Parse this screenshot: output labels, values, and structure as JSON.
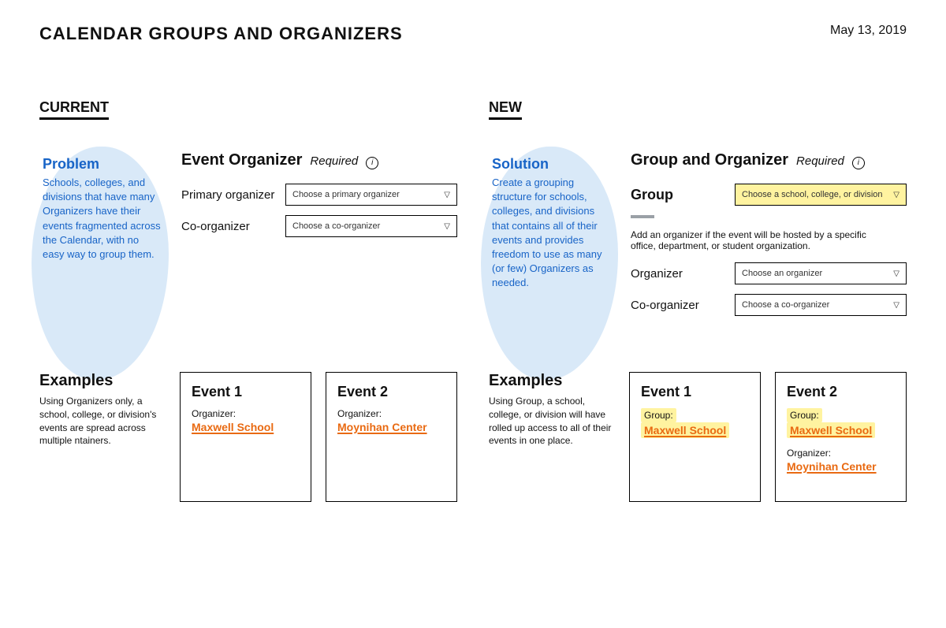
{
  "header": {
    "title": "CALENDAR GROUPS AND ORGANIZERS",
    "date": "May 13, 2019"
  },
  "current": {
    "section_label": "CURRENT",
    "annotation": {
      "title": "Problem",
      "body": "Schools, colleges, and divisions that have many Organizers have their events fragmented across the Calendar, with no easy way to group them."
    },
    "form": {
      "heading": "Event Organizer",
      "required": "Required",
      "rows": {
        "primary": {
          "label": "Primary organizer",
          "placeholder": "Choose a primary organizer"
        },
        "co": {
          "label": "Co-organizer",
          "placeholder": "Choose a co-organizer"
        }
      }
    },
    "examples": {
      "title": "Examples",
      "body": "Using Organizers only, a school, college, or division's events are spread across multiple ntainers."
    },
    "cards": {
      "event1": {
        "title": "Event 1",
        "organizer_label": "Organizer:",
        "organizer_value": "Maxwell School"
      },
      "event2": {
        "title": "Event 2",
        "organizer_label": "Organizer:",
        "organizer_value": "Moynihan Center"
      }
    }
  },
  "new": {
    "section_label": "NEW",
    "annotation": {
      "title": "Solution",
      "body": "Create a grouping structure for schools, colleges, and divisions that contains all of their events and provides freedom to use as many (or few) Organizers as needed."
    },
    "form": {
      "heading": "Group and Organizer",
      "required": "Required",
      "group_row": {
        "label": "Group",
        "placeholder": "Choose a school, college, or division"
      },
      "helper": "Add an organizer if the event will be hosted by a specific office, department, or student organization.",
      "rows": {
        "organizer": {
          "label": "Organizer",
          "placeholder": "Choose an organizer"
        },
        "co": {
          "label": "Co-organizer",
          "placeholder": "Choose a co-organizer"
        }
      }
    },
    "examples": {
      "title": "Examples",
      "body": "Using Group, a school, college, or division will have rolled up access to all of their events in one place."
    },
    "cards": {
      "event1": {
        "title": "Event 1",
        "group_label": "Group:",
        "group_value": "Maxwell School"
      },
      "event2": {
        "title": "Event 2",
        "group_label": "Group:",
        "group_value": "Maxwell School",
        "organizer_label": "Organizer:",
        "organizer_value": "Moynihan Center"
      }
    }
  }
}
